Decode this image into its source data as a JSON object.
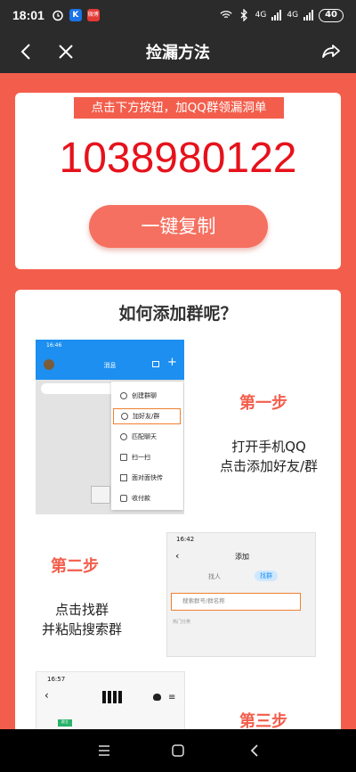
{
  "status_bar": {
    "time": "18:01",
    "app_a": "K",
    "app_b": "微博",
    "net1": "4G",
    "net2": "4G",
    "battery": "40"
  },
  "nav": {
    "title": "捡漏方法",
    "back_icon": "back-arrow-icon",
    "close_icon": "close-icon",
    "share_icon": "share-icon"
  },
  "promo": {
    "hint": "点击下方按钮，加QQ群领漏洞单",
    "qq_number": "1038980122",
    "copy_label": "一键复制"
  },
  "guide": {
    "title": "如何添加群呢？",
    "step1": {
      "label": "第一步",
      "line1": "打开手机QQ",
      "line2": "点击添加好友/群",
      "shot": {
        "time": "16:46",
        "header_title": "消息",
        "menu": [
          "创建群聊",
          "加好友/群",
          "匹配聊天",
          "扫一扫",
          "面对面快传",
          "收付款"
        ]
      }
    },
    "step2": {
      "label": "第二步",
      "line1": "点击找群",
      "line2": "并粘贴搜索群",
      "shot": {
        "time": "16:42",
        "title": "添加",
        "tab_person": "找人",
        "tab_group": "找群",
        "search_placeholder": "搜索群号/群名称",
        "footer": "热门分类"
      }
    },
    "step3": {
      "label": "第三步",
      "shot": {
        "time": "16:57",
        "badge": "群主"
      }
    }
  },
  "android_nav": {
    "menu_icon": "menu-icon",
    "home_icon": "home-icon",
    "back_icon": "back-icon"
  },
  "colors": {
    "accent": "#f35e4c",
    "number_red": "#e6121b",
    "topbar": "#2b2b2b"
  }
}
